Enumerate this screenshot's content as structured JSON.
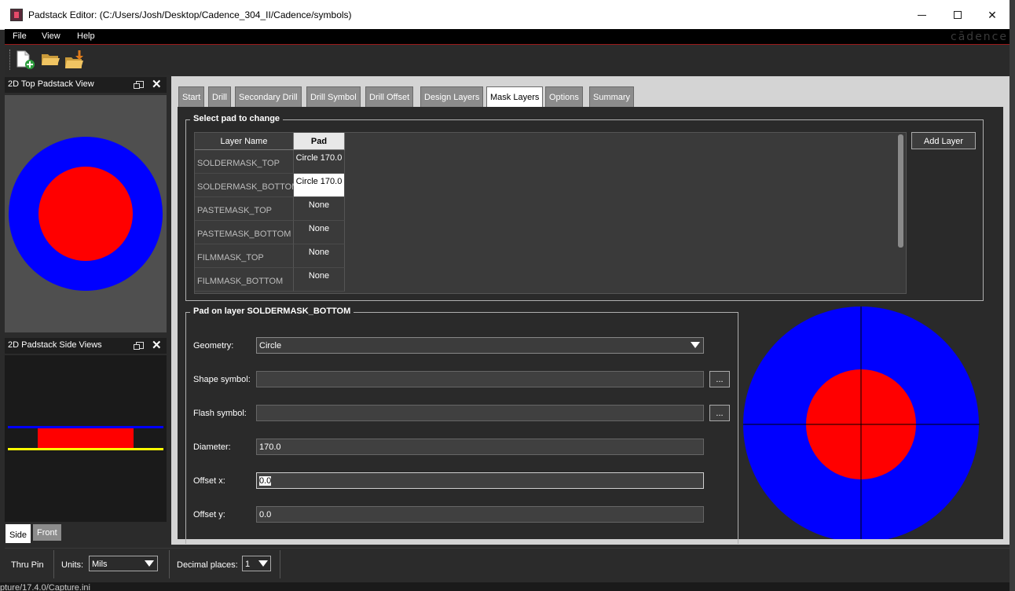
{
  "window": {
    "title": "Padstack Editor:   (C:/Users/Josh/Desktop/Cadence_304_II/Cadence/symbols)"
  },
  "menubar": {
    "items": [
      "File",
      "View",
      "Help"
    ],
    "brand": "cādence"
  },
  "toolbar": {
    "icons": [
      "new-padstack-icon",
      "open-folder-icon",
      "import-icon"
    ]
  },
  "panels": {
    "top_view_title": "2D Top Padstack View",
    "side_view_title": "2D Padstack Side Views",
    "side_tabs": [
      "Side",
      "Front"
    ],
    "colors": {
      "outer": "#0000ff",
      "inner": "#ff0000",
      "line_yellow": "#ffff00"
    }
  },
  "tabs": [
    "Start",
    "Drill",
    "Secondary Drill",
    "Drill Symbol",
    "Drill Offset",
    "Design Layers",
    "Mask Layers",
    "Options",
    "Summary"
  ],
  "active_tab": "Mask Layers",
  "select_pad": {
    "group_title": "Select pad to change",
    "headers": {
      "layer_name": "Layer Name",
      "pad": "Pad"
    },
    "rows": [
      {
        "layer": "SOLDERMASK_TOP",
        "pad": "Circle 170.0"
      },
      {
        "layer": "SOLDERMASK_BOTTOM",
        "pad": "Circle 170.0"
      },
      {
        "layer": "PASTEMASK_TOP",
        "pad": "None"
      },
      {
        "layer": "PASTEMASK_BOTTOM",
        "pad": "None"
      },
      {
        "layer": "FILMMASK_TOP",
        "pad": "None"
      },
      {
        "layer": "FILMMASK_BOTTOM",
        "pad": "None"
      }
    ],
    "selected_row": "SOLDERMASK_BOTTOM",
    "add_layer_button": "Add Layer"
  },
  "pad_on_layer": {
    "group_title": "Pad on layer SOLDERMASK_BOTTOM",
    "geometry_label": "Geometry:",
    "geometry_value": "Circle",
    "shape_symbol_label": "Shape symbol:",
    "shape_symbol_value": "",
    "flash_symbol_label": "Flash symbol:",
    "flash_symbol_value": "",
    "browse_label": "...",
    "diameter_label": "Diameter:",
    "diameter_value": "170.0",
    "offset_x_label": "Offset x:",
    "offset_x_value": "0.0",
    "offset_y_label": "Offset y:",
    "offset_y_value": "0.0"
  },
  "statusbar": {
    "pin_type": "Thru Pin",
    "units_label": "Units:",
    "units_value": "Mils",
    "decimal_label": "Decimal places:",
    "decimal_value": "1"
  },
  "bottom_text": "pture/17.4.0/Capture.ini"
}
